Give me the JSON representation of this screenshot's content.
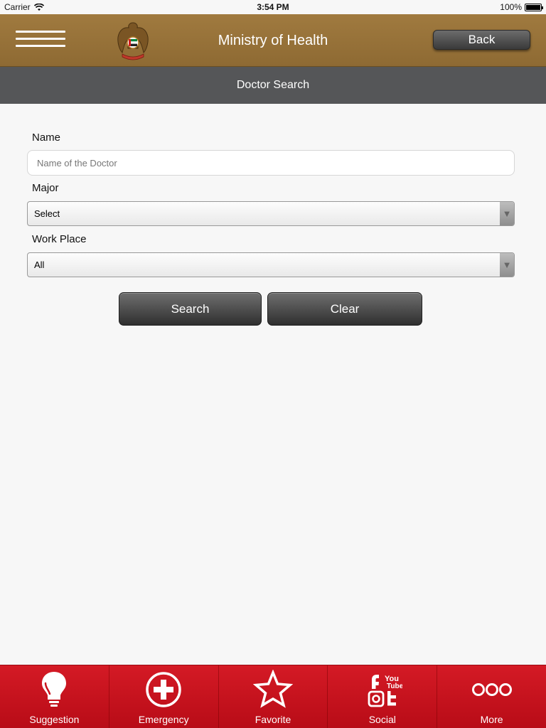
{
  "status": {
    "carrier": "Carrier",
    "time": "3:54 PM",
    "battery": "100%",
    "battery_level": 1.0
  },
  "header": {
    "title": "Ministry of Health",
    "back_label": "Back",
    "subtitle": "Doctor Search"
  },
  "form": {
    "name_label": "Name",
    "name_placeholder": "Name of the Doctor",
    "name_value": "",
    "major_label": "Major",
    "major_value": "Select",
    "workplace_label": "Work Place",
    "workplace_value": "All",
    "search_label": "Search",
    "clear_label": "Clear"
  },
  "tabs": [
    {
      "label": "Suggestion",
      "icon": "lightbulb-icon"
    },
    {
      "label": "Emergency",
      "icon": "plus-circle-icon"
    },
    {
      "label": "Favorite",
      "icon": "star-icon"
    },
    {
      "label": "Social",
      "icon": "social-icon"
    },
    {
      "label": "More",
      "icon": "more-icon"
    }
  ],
  "colors": {
    "brand_bar": "#9a7538",
    "subheader": "#555658",
    "tabbar": "#c8121d"
  }
}
